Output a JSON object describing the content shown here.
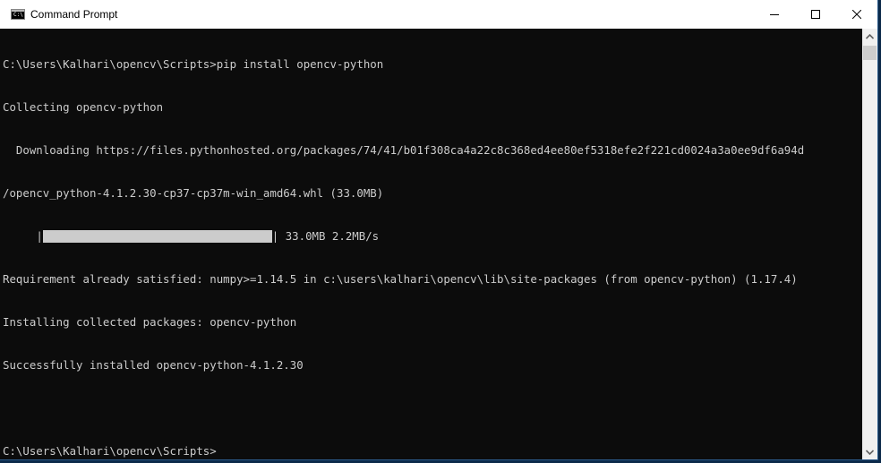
{
  "window": {
    "title": "Command Prompt",
    "icon": "cmd-icon",
    "icon_text": "C:\\",
    "controls": [
      "minimize-icon",
      "maximize-icon",
      "close-icon"
    ]
  },
  "console": {
    "lines": [
      "C:\\Users\\Kalhari\\opencv\\Scripts>pip install opencv-python",
      "Collecting opencv-python",
      "  Downloading https://files.pythonhosted.org/packages/74/41/b01f308ca4a22c8c368ed4ee80ef5318efe2f221cd0024a3a0ee9df6a94d",
      "/opencv_python-4.1.2.30-cp37-cp37m-win_amd64.whl (33.0MB)"
    ],
    "progress": {
      "indent": "     ",
      "left_edge": "|",
      "right_edge": "|",
      "percent": 100,
      "stats": " 33.0MB 2.2MB/s"
    },
    "lines_after": [
      "Requirement already satisfied: numpy>=1.14.5 in c:\\users\\kalhari\\opencv\\lib\\site-packages (from opencv-python) (1.17.4)",
      "Installing collected packages: opencv-python",
      "Successfully installed opencv-python-4.1.2.30",
      "",
      "C:\\Users\\Kalhari\\opencv\\Scripts>"
    ]
  },
  "scrollbar": {
    "up_icon": "chevron-up-icon",
    "down_icon": "chevron-down-icon"
  }
}
